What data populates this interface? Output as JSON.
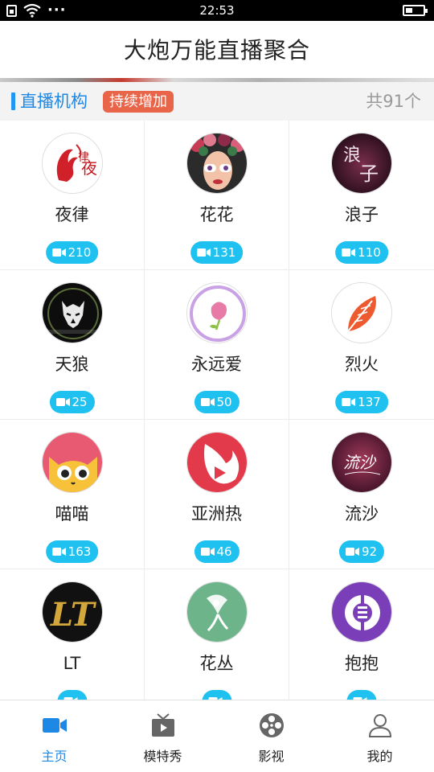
{
  "status_bar": {
    "time": "22:53",
    "more": "···"
  },
  "header": {
    "title": "大炮万能直播聚合"
  },
  "section": {
    "title": "直播机构",
    "tag": "持续增加",
    "count": "共91个"
  },
  "items": [
    {
      "name": "夜律",
      "count": "210",
      "avatar_icon": "yelv-logo"
    },
    {
      "name": "花花",
      "count": "131",
      "avatar_icon": "huahua-logo"
    },
    {
      "name": "浪子",
      "count": "110",
      "avatar_icon": "langzi-logo"
    },
    {
      "name": "天狼",
      "count": "25",
      "avatar_icon": "tianlang-logo"
    },
    {
      "name": "永远爱",
      "count": "50",
      "avatar_icon": "yongyuanai-logo"
    },
    {
      "name": "烈火",
      "count": "137",
      "avatar_icon": "liehuo-logo"
    },
    {
      "name": "喵喵",
      "count": "163",
      "avatar_icon": "miaomiao-logo"
    },
    {
      "name": "亚洲热",
      "count": "46",
      "avatar_icon": "yazhoure-logo"
    },
    {
      "name": "流沙",
      "count": "92",
      "avatar_icon": "liusha-logo"
    },
    {
      "name": "LT",
      "count": "",
      "avatar_icon": "lt-logo"
    },
    {
      "name": "花丛",
      "count": "",
      "avatar_icon": "huacong-logo"
    },
    {
      "name": "抱抱",
      "count": "",
      "avatar_icon": "baobao-logo"
    }
  ],
  "nav": [
    {
      "label": "主页",
      "icon": "video-camera-icon",
      "active": true
    },
    {
      "label": "模特秀",
      "icon": "tv-icon",
      "active": false
    },
    {
      "label": "影视",
      "icon": "film-reel-icon",
      "active": false
    },
    {
      "label": "我的",
      "icon": "person-icon",
      "active": false
    }
  ],
  "colors": {
    "accent": "#1e88e5",
    "badge": "#1ec1ef",
    "tag": "#e8654a"
  }
}
